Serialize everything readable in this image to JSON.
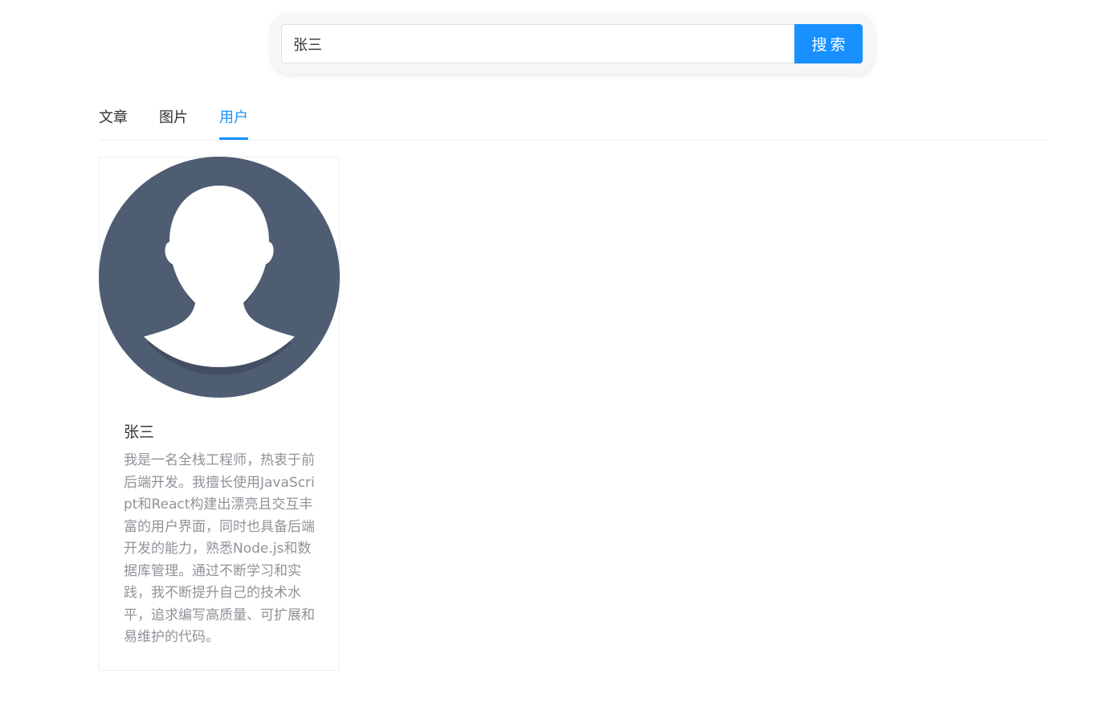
{
  "search": {
    "value": "张三",
    "button_label": "搜索"
  },
  "tabs": [
    {
      "label": "文章",
      "active": false
    },
    {
      "label": "图片",
      "active": false
    },
    {
      "label": "用户",
      "active": true
    }
  ],
  "user_card": {
    "avatar_icon": "default-user-avatar-icon",
    "name": "张三",
    "bio": "我是一名全栈工程师，热衷于前后端开发。我擅长使用JavaScript和React构建出漂亮且交互丰富的用户界面，同时也具备后端开发的能力，熟悉Node.js和数据库管理。通过不断学习和实践，我不断提升自己的技术水平，追求编写高质量、可扩展和易维护的代码。"
  },
  "colors": {
    "accent": "#1890ff",
    "avatar_bg": "#4e5d72",
    "muted_text": "#909399"
  }
}
